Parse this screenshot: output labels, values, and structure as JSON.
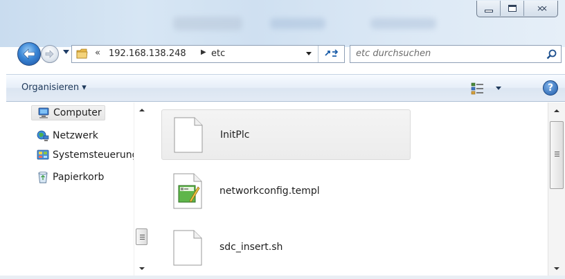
{
  "window": {
    "minimize_icon": "minimize-icon",
    "maximize_icon": "maximize-icon",
    "close_glyph": "⨯⨯"
  },
  "address": {
    "chevrons": "«",
    "path_host": "192.168.138.248",
    "separator": "▶",
    "path_folder": "etc",
    "refresh_glyph": "⁴↻"
  },
  "search": {
    "placeholder": "etc durchsuchen",
    "icon": "search-icon"
  },
  "toolbar": {
    "organize_label": "Organisieren ▾",
    "help_label": "?"
  },
  "navigation": {
    "items": [
      {
        "label": "Computer",
        "icon": "computer-icon",
        "selected": true
      },
      {
        "label": "Netzwerk",
        "icon": "network-icon"
      },
      {
        "label": "Systemsteuerung",
        "icon": "control-panel-icon"
      },
      {
        "label": "Papierkorb",
        "icon": "recycle-bin-icon"
      }
    ]
  },
  "files": [
    {
      "name": "InitPlc",
      "icon": "blank-document-icon",
      "selected": true
    },
    {
      "name": "networkconfig.templ",
      "icon": "template-document-icon"
    },
    {
      "name": "sdc_insert.sh",
      "icon": "blank-document-icon"
    }
  ],
  "colors": {
    "glass_accent": "#cfe0f1",
    "selection_bg": "#ececec",
    "link_blue": "#1c5ea9"
  }
}
